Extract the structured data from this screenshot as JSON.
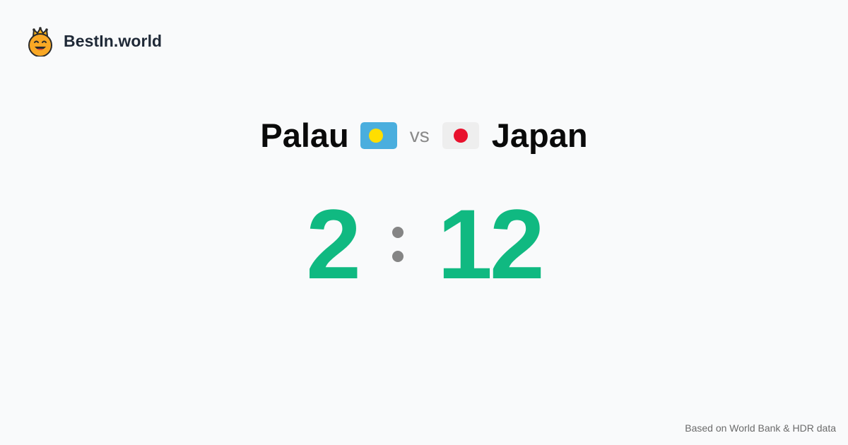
{
  "brand": {
    "name": "BestIn.world",
    "logo_icon": "crowned-smiley-icon"
  },
  "matchup": {
    "left_country": "Palau",
    "left_flag_icon": "palau-flag-icon",
    "vs_label": "vs",
    "right_country": "Japan",
    "right_flag_icon": "japan-flag-icon"
  },
  "score": {
    "left": "2",
    "right": "12",
    "color": "#10b981"
  },
  "footer": {
    "source": "Based on World Bank & HDR data"
  },
  "colors": {
    "background": "#f9fafb",
    "palau_flag_field": "#4aaede",
    "palau_flag_disc": "#ffde00",
    "japan_flag_field": "#eeeeee",
    "japan_flag_disc": "#e8112d",
    "separator": "#858585"
  }
}
